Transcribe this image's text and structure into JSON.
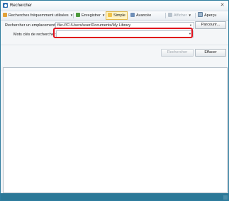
{
  "window": {
    "title": "Rechercher",
    "close_glyph": "✕"
  },
  "toolbar": {
    "frequent_label": "Recherches fréquemment utilisées",
    "save_label": "Enregistrer",
    "simple_label": "Simple",
    "advanced_label": "Avancée",
    "display_label": "Afficher",
    "preview_label": "Aperçu",
    "caret": "▼"
  },
  "search": {
    "location_label": "Rechercher un emplacement :",
    "location_value": "file:///C:/Users/user/Documents/My Library",
    "browse_label": "Parcourir...",
    "keywords_label": "Mots clés de recherche :",
    "keywords_value": "",
    "dropdown_glyph": "▼",
    "search_button": "Rechercher",
    "clear_button": "Effacer"
  },
  "colors": {
    "highlight": "#e0101c",
    "statusbar": "#2b7897",
    "selected_bg": "#fff3c4"
  }
}
